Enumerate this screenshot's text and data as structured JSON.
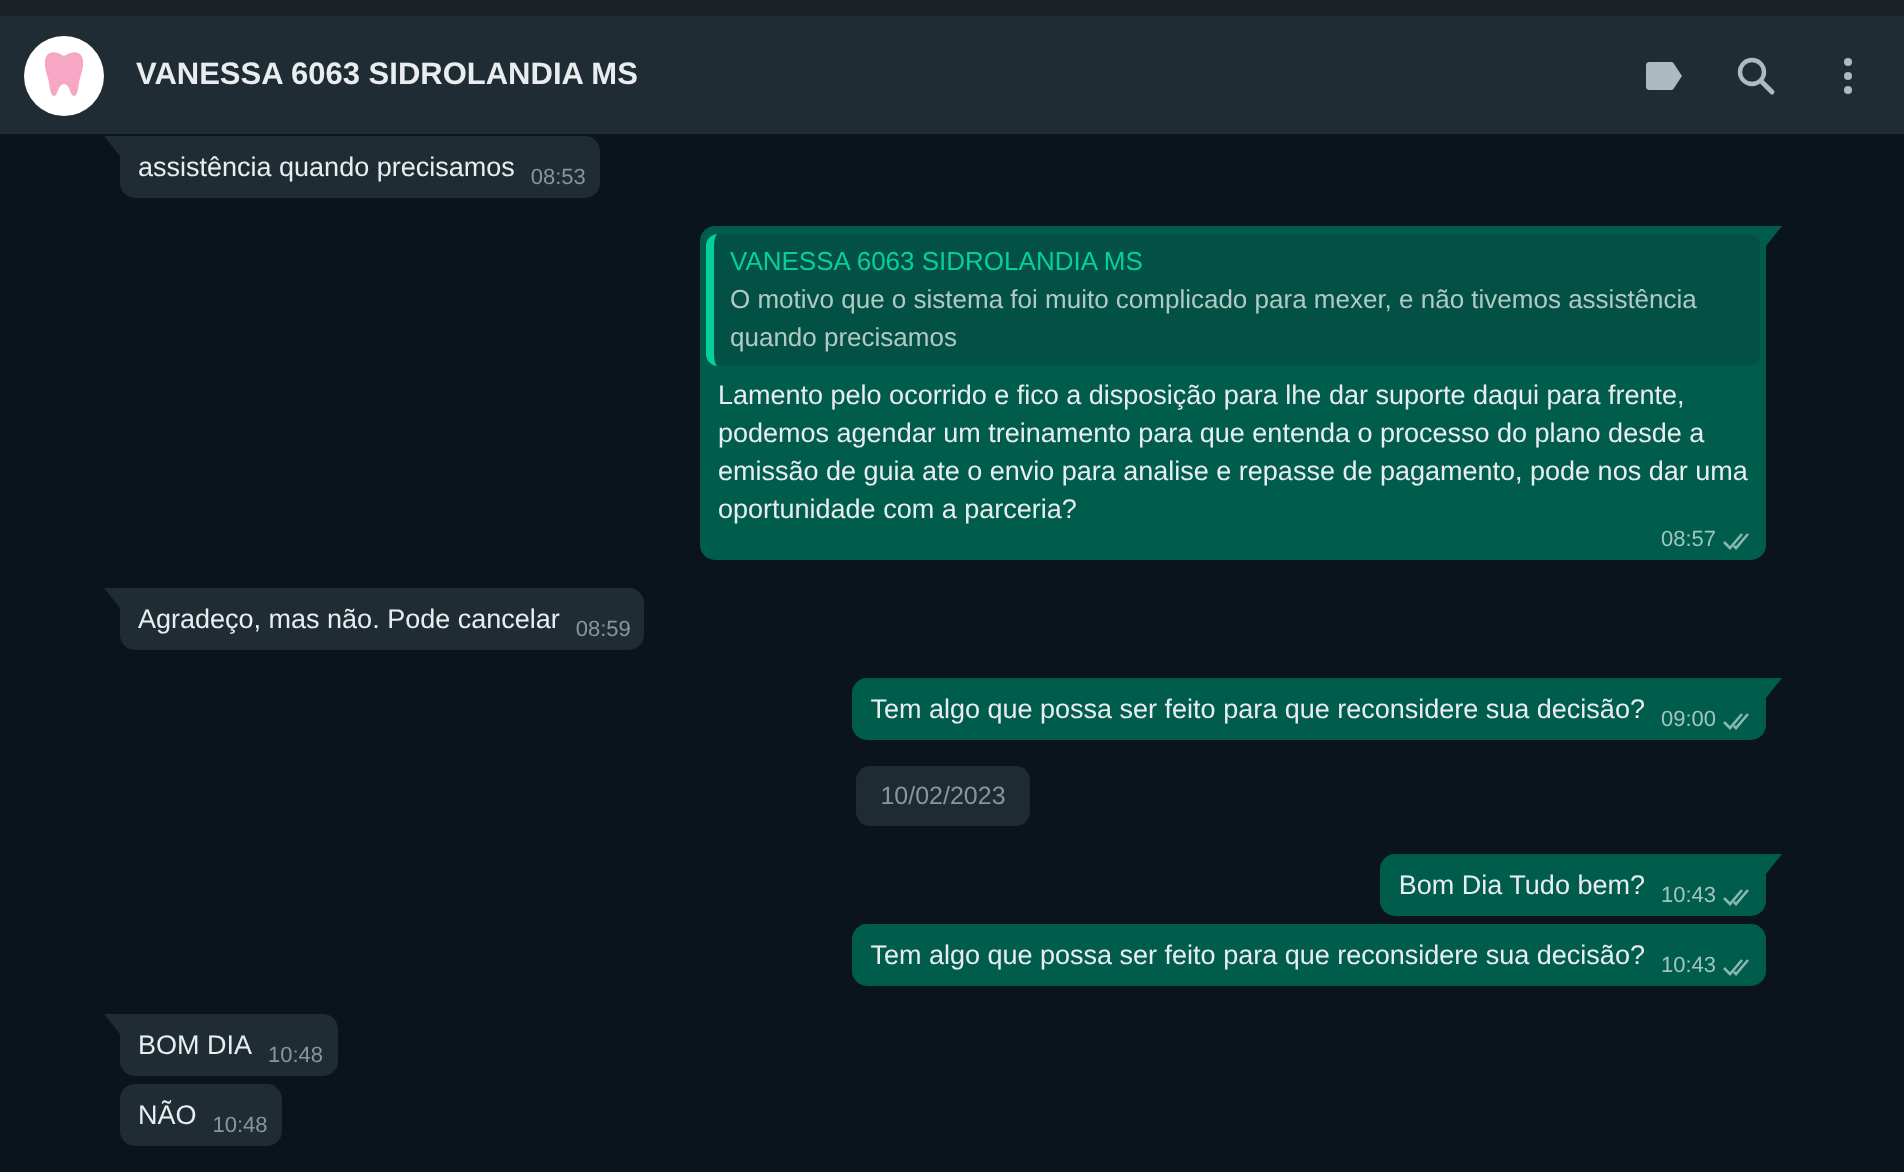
{
  "header": {
    "title": "VANESSA 6063 SIDROLANDIA MS"
  },
  "messages": [
    {
      "kind": "incoming",
      "text": "assistência quando precisamos",
      "time": "08:53"
    },
    {
      "kind": "outgoing",
      "quote": {
        "author": "VANESSA 6063 SIDROLANDIA MS",
        "text": "O motivo que o sistema foi muito complicado para mexer, e não tivemos assistência quando precisamos"
      },
      "text": "Lamento pelo ocorrido e fico a disposição para lhe dar suporte daqui para frente, podemos agendar um treinamento para que entenda o processo do plano desde a emissão de guia ate o envio para analise e repasse de pagamento, pode nos dar uma oportunidade com a parceria?",
      "time": "08:57",
      "read": false
    },
    {
      "kind": "incoming",
      "text": "Agradeço, mas não. Pode cancelar",
      "time": "08:59"
    },
    {
      "kind": "outgoing",
      "text": "Tem algo que possa ser feito para que reconsidere sua decisão?",
      "time": "09:00",
      "read": false
    },
    {
      "kind": "date",
      "text": "10/02/2023"
    },
    {
      "kind": "outgoing",
      "text": "Bom Dia Tudo bem?",
      "time": "10:43",
      "read": false
    },
    {
      "kind": "outgoing",
      "text": "Tem algo que possa ser feito para que reconsidere sua decisão?",
      "time": "10:43",
      "read": false
    },
    {
      "kind": "incoming",
      "text": "BOM DIA",
      "time": "10:48"
    },
    {
      "kind": "incoming",
      "text": "NÃO",
      "time": "10:48"
    }
  ]
}
